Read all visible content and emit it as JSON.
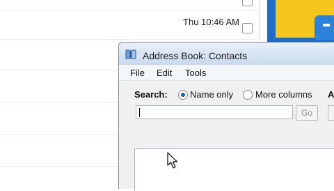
{
  "background_list": {
    "time_label": "Thu 10:46 AM"
  },
  "window": {
    "title": "Address Book: Contacts",
    "menu": [
      "File",
      "Edit",
      "Tools"
    ],
    "search": {
      "label": "Search:",
      "options": [
        "Name only",
        "More columns"
      ],
      "selected": "Name only",
      "cut_label": "A",
      "input_value": "",
      "go_label": "Go"
    }
  },
  "icons": {
    "title": "address-book-icon",
    "cursor": "mouse-pointer-icon"
  },
  "colors": {
    "accent_blue": "#1e6cc8",
    "accent_yellow": "#f5c61d",
    "radio_selected": "#1a5fb4"
  }
}
